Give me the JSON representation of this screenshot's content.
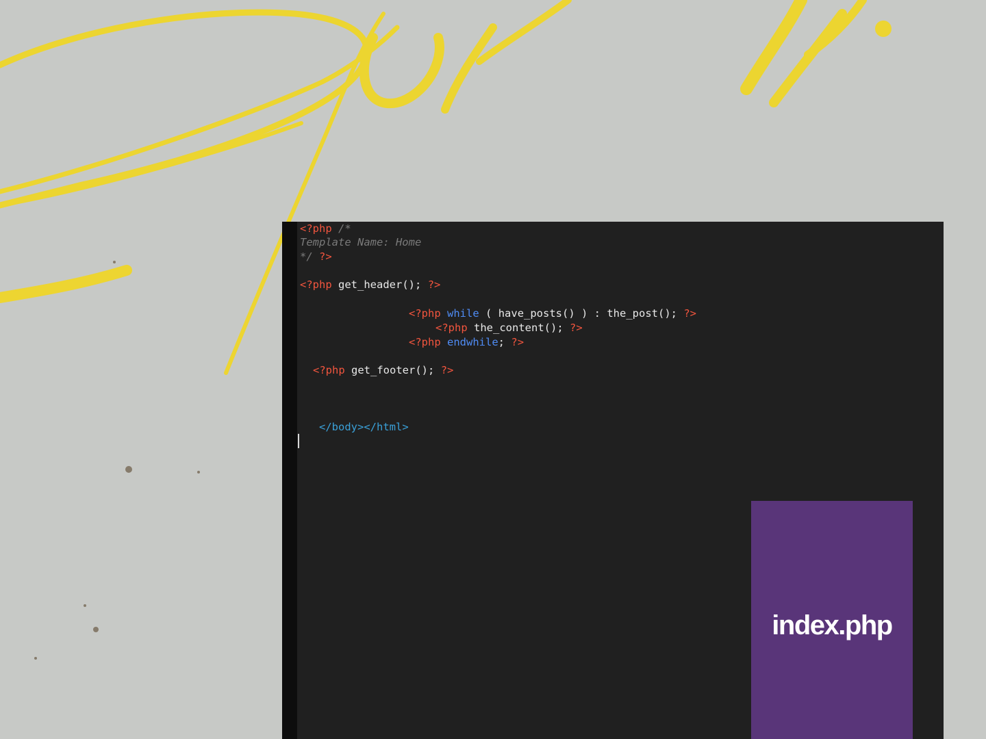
{
  "editor": {
    "lines": {
      "l1": {
        "tag_open": "<?php",
        "comment": " /*"
      },
      "l2": {
        "comment": "Template Name: Home"
      },
      "l3": {
        "comment": "*/",
        "tag_close": "?>"
      },
      "l4": {
        "tag_open": "<?php",
        "call": "get_header();",
        "tag_close": "?>"
      },
      "l5": {
        "tag_open": "<?php",
        "keyword": "while",
        "rest": "( have_posts() ) : the_post();",
        "tag_close": "?>"
      },
      "l6": {
        "tag_open": "<?php",
        "call": "the_content();",
        "tag_close": "?>"
      },
      "l7": {
        "tag_open": "<?php",
        "keyword": "endwhile",
        "rest": ";",
        "tag_close": "?>"
      },
      "l8": {
        "tag_open": "<?php",
        "call": "get_footer();",
        "tag_close": "?>"
      },
      "l9": {
        "html": "</body></html>"
      }
    }
  },
  "badge": {
    "label": "index.php"
  },
  "colors": {
    "wall": "#c7c9c6",
    "graffiti": "#efd629",
    "editor_bg": "#202020",
    "php_tag": "#f2553e",
    "keyword": "#4f8cf5",
    "comment": "#7a7a7a",
    "html_tag": "#3aa0d8",
    "badge_bg": "#593579"
  }
}
